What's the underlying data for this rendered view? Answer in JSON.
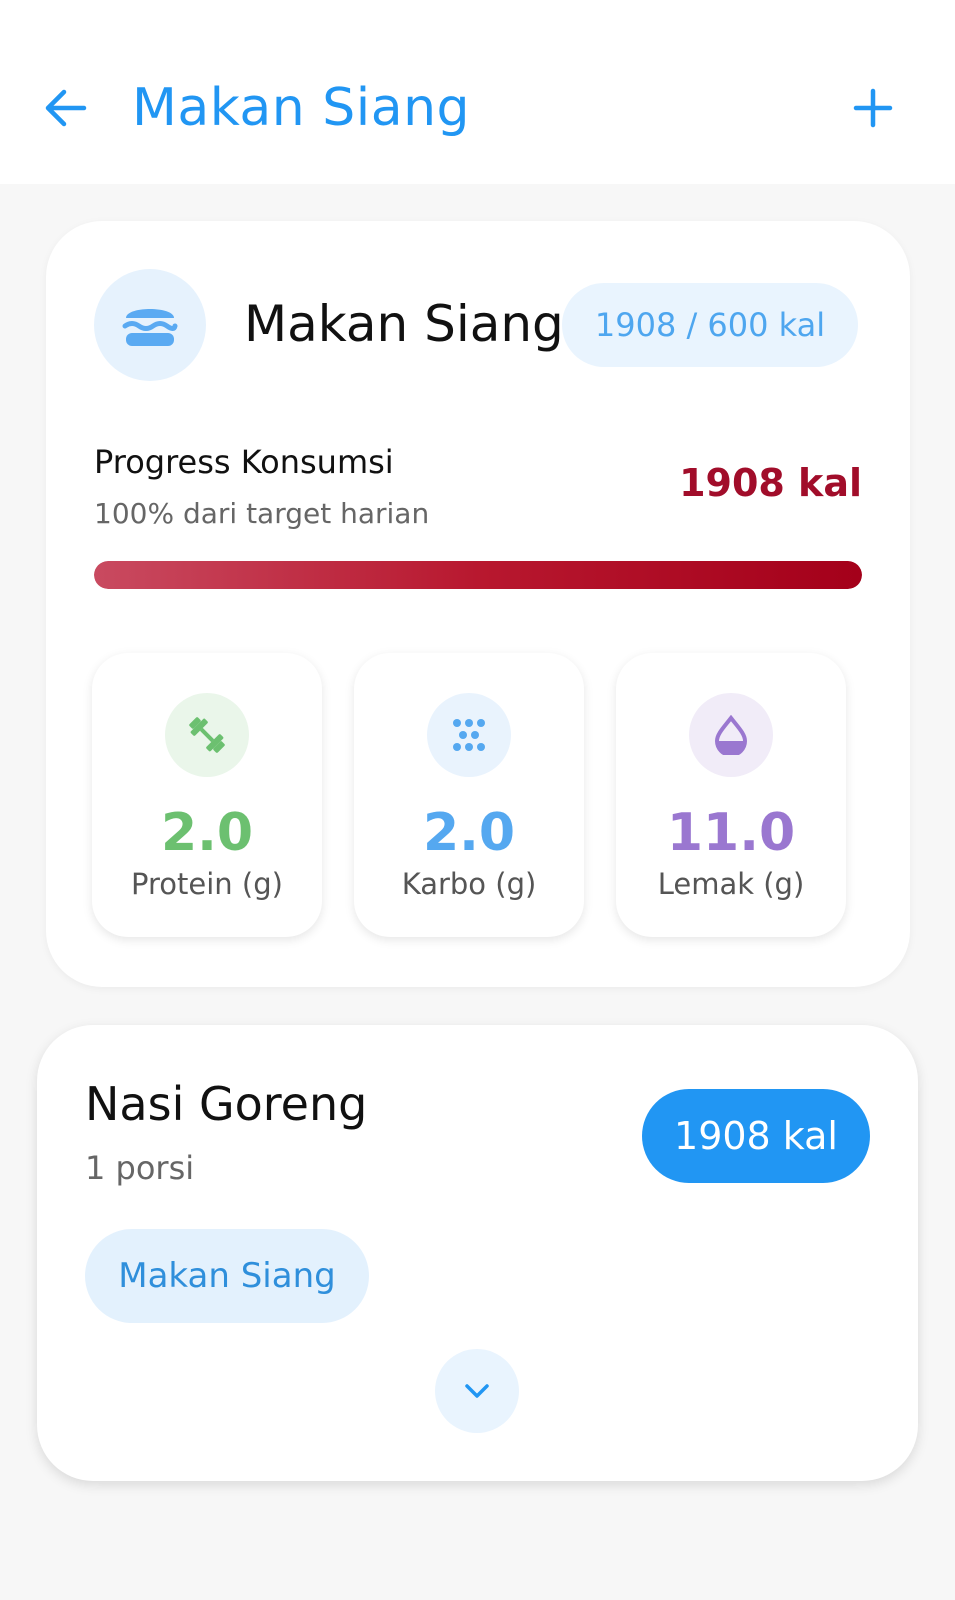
{
  "appbar": {
    "title": "Makan Siang",
    "back_icon": "arrow-left-icon",
    "add_icon": "plus-icon"
  },
  "summary": {
    "title": "Makan Siang",
    "icon": "burger-icon",
    "target_label": "1908 / 600 kal",
    "progress_label": "Progress Konsumsi",
    "progress_sub": "100% dari target harian",
    "progress_kal": "1908 kal",
    "progress_fraction": 1.0,
    "macros": [
      {
        "value": "2.0",
        "label": "Protein (g)",
        "icon": "dumbbell-icon",
        "color": "#6cc070",
        "bg": "#eaf6ea"
      },
      {
        "value": "2.0",
        "label": "Karbo (g)",
        "icon": "grain-dots-icon",
        "color": "#55a8f0",
        "bg": "#e9f3fd"
      },
      {
        "value": "11.0",
        "label": "Lemak (g)",
        "icon": "drop-icon",
        "color": "#9a77d0",
        "bg": "#f1ecf8"
      }
    ]
  },
  "food": {
    "name": "Nasi Goreng",
    "portion": "1 porsi",
    "kal": "1908 kal",
    "tag": "Makan Siang",
    "expand_icon": "chevron-down-icon"
  },
  "colors": {
    "primary": "#2196f3",
    "danger": "#a10d2a"
  }
}
